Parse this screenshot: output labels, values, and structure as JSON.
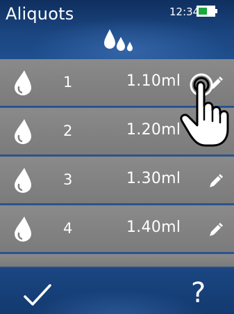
{
  "header": {
    "title": "Aliquots",
    "time": "12:34",
    "battery_level": 0.55,
    "icon": "drops-icon"
  },
  "aliquots": [
    {
      "index": "1",
      "volume": "1.10ml",
      "icon": "drop-icon",
      "action_icon": "pencil-icon"
    },
    {
      "index": "2",
      "volume": "1.20ml",
      "icon": "drop-icon",
      "action_icon": "pencil-icon"
    },
    {
      "index": "3",
      "volume": "1.30ml",
      "icon": "drop-icon",
      "action_icon": "pencil-icon"
    },
    {
      "index": "4",
      "volume": "1.40ml",
      "icon": "drop-icon",
      "action_icon": "pencil-icon"
    }
  ],
  "footer": {
    "confirm_icon": "checkmark-icon",
    "help_label": "?"
  },
  "overlay": {
    "icon": "pointing-hand-cursor-icon"
  },
  "colors": {
    "row_bg": "#808080",
    "header_bg": "#1a4580",
    "battery_fill": "#18a83c",
    "text": "#ffffff"
  }
}
